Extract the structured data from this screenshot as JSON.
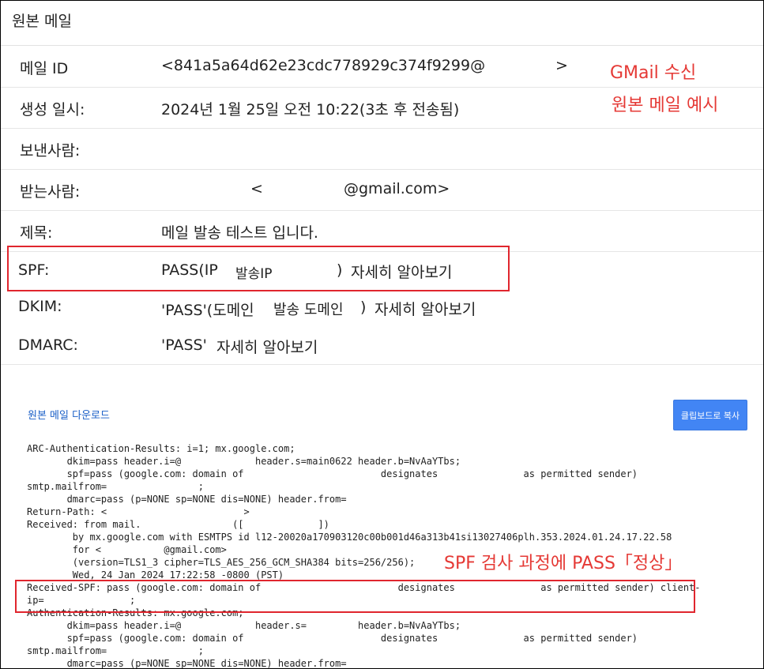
{
  "header": {
    "title": "원본 메일"
  },
  "rows": {
    "message_id": {
      "label": "메일 ID",
      "value_start": "<841a5a64d62e23cdc778929c374f9299@",
      "value_end": ">"
    },
    "created": {
      "label": "생성 일시:",
      "value": "2024년 1월 25일 오전 10:22(3초 후 전송됨)"
    },
    "from": {
      "label": "보낸사람:",
      "value": ""
    },
    "to": {
      "label": "받는사람:",
      "value_start": "<",
      "value_end": "@gmail.com>"
    },
    "subject": {
      "label": "제목:",
      "value": "메일 발송 테스트 입니다."
    },
    "spf": {
      "label": "SPF:",
      "value_start": "PASS(IP",
      "red_text": "발송IP",
      "value_end": ")",
      "learn_more": "자세히 알아보기"
    },
    "dkim": {
      "label": "DKIM:",
      "value_start": "'PASS'(도메인",
      "red_text": "발송 도메인",
      "value_end": ")",
      "learn_more": "자세히 알아보기"
    },
    "dmarc": {
      "label": "DMARC:",
      "value": "'PASS'",
      "learn_more": "자세히 알아보기"
    }
  },
  "annotations": {
    "gmail_1": "GMail 수신",
    "gmail_2": "원본 메일 예시",
    "spf_check": "SPF 검사 과정에 PASS「정상」"
  },
  "download_link": "원본 메일 다운로드",
  "copy_button": "클립보드로 복사",
  "raw_lines": [
    "ARC-Authentication-Results: i=1; mx.google.com;",
    "       dkim=pass header.i=@             header.s=main0622 header.b=NvAaYTbs;",
    "       spf=pass (google.com: domain of                        designates               as permitted sender)",
    "smtp.mailfrom=                ;",
    "       dmarc=pass (p=NONE sp=NONE dis=NONE) header.from=",
    "Return-Path: <                        >",
    "Received: from mail.                ([             ])",
    "        by mx.google.com with ESMTPS id l12-20020a170903120c00b001d46a313b41si13027406plh.353.2024.01.24.17.22.58",
    "        for <           @gmail.com>",
    "        (version=TLS1_3 cipher=TLS_AES_256_GCM_SHA384 bits=256/256);",
    "        Wed, 24 Jan 2024 17:22:58 -0800 (PST)",
    "Received-SPF: pass (google.com: domain of                        designates               as permitted sender) client-",
    "ip=               ;",
    "Authentication-Results: mx.google.com;",
    "       dkim=pass header.i=@             header.s=         header.b=NvAaYTbs;",
    "       spf=pass (google.com: domain of                        designates               as permitted sender)",
    "smtp.mailfrom=                ;",
    "       dmarc=pass (p=NONE sp=NONE dis=NONE) header.from="
  ]
}
